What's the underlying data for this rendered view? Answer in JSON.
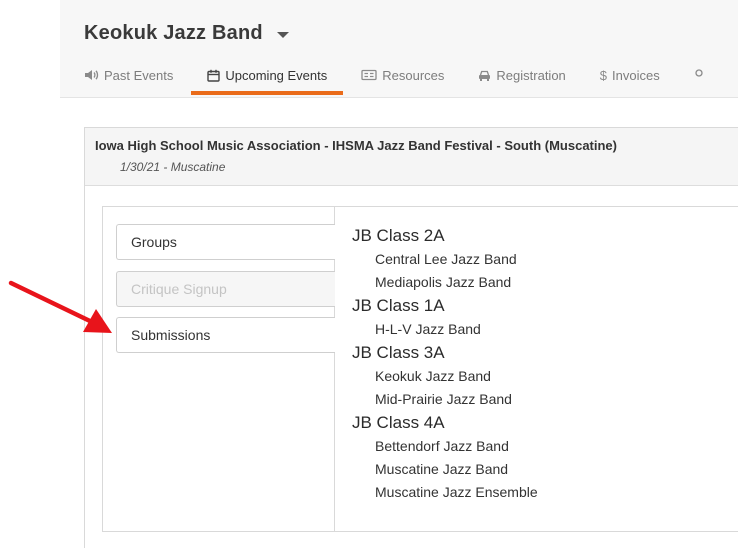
{
  "header": {
    "band_title": "Keokuk Jazz Band",
    "tabs": [
      {
        "label": "Past Events",
        "icon": "speaker-icon"
      },
      {
        "label": "Upcoming Events",
        "icon": "calendar-icon"
      },
      {
        "label": "Resources",
        "icon": "resources-icon"
      },
      {
        "label": "Registration",
        "icon": "car-icon"
      },
      {
        "label": "Invoices",
        "icon": "dollar-icon"
      },
      {
        "label": "",
        "icon": "more-icon"
      }
    ],
    "active_tab": "Upcoming Events"
  },
  "event": {
    "title": "Iowa High School Music Association - IHSMA Jazz Band Festival - South (Muscatine)",
    "subtitle": "1/30/21 - Muscatine"
  },
  "sidebar": {
    "items": [
      {
        "label": "Groups",
        "enabled": true
      },
      {
        "label": "Critique Signup",
        "enabled": false
      },
      {
        "label": "Submissions",
        "enabled": true
      }
    ]
  },
  "classes": [
    {
      "name": "JB Class 2A",
      "bands": [
        "Central Lee Jazz Band",
        "Mediapolis Jazz Band"
      ]
    },
    {
      "name": "JB Class 1A",
      "bands": [
        "H-L-V Jazz Band"
      ]
    },
    {
      "name": "JB Class 3A",
      "bands": [
        "Keokuk Jazz Band",
        "Mid-Prairie Jazz Band"
      ]
    },
    {
      "name": "JB Class 4A",
      "bands": [
        "Bettendorf Jazz Band",
        "Muscatine Jazz Band",
        "Muscatine Jazz Ensemble"
      ]
    }
  ],
  "colors": {
    "accent": "#ea6b1a",
    "annotation_arrow": "#e8141b"
  }
}
